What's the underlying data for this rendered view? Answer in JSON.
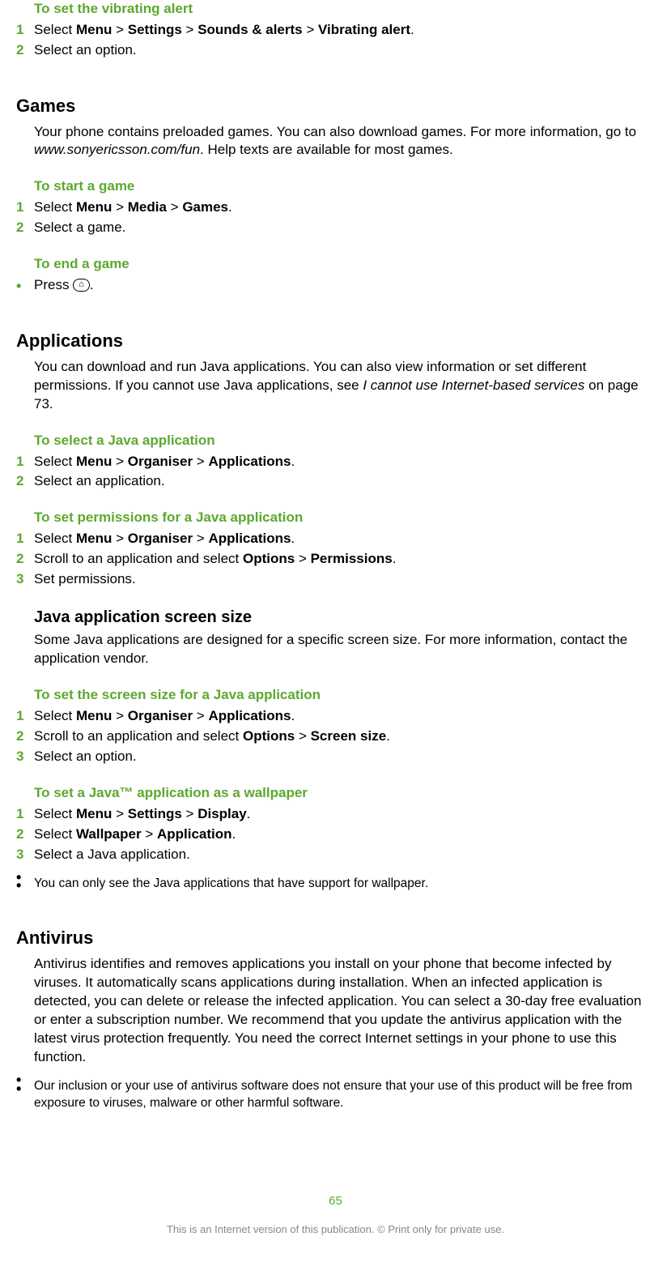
{
  "sec_vibrating": {
    "heading": "To set the vibrating alert",
    "steps": [
      {
        "n": "1",
        "html": "Select <b>Menu</b> > <b>Settings</b> > <b>Sounds & alerts</b> > <b>Vibrating alert</b>."
      },
      {
        "n": "2",
        "html": "Select an option."
      }
    ]
  },
  "sec_games": {
    "title": "Games",
    "intro_html": "Your phone contains preloaded games. You can also download games. For more information, go to <i>www.sonyericsson.com/fun</i>. Help texts are available for most games.",
    "start": {
      "heading": "To start a game",
      "steps": [
        {
          "n": "1",
          "html": "Select <b>Menu</b> > <b>Media</b> > <b>Games</b>."
        },
        {
          "n": "2",
          "html": "Select a game."
        }
      ]
    },
    "end": {
      "heading": "To end a game",
      "bullet_html": "Press <span class='icon-key'>⌂</span>."
    }
  },
  "sec_apps": {
    "title": "Applications",
    "intro_html": "You can download and run Java applications. You can also view information or set different permissions. If you cannot use Java applications, see <i>I cannot use Internet-based services</i> on page 73.",
    "select": {
      "heading": "To select a Java application",
      "steps": [
        {
          "n": "1",
          "html": "Select <b>Menu</b> > <b>Organiser</b> > <b>Applications</b>."
        },
        {
          "n": "2",
          "html": "Select an application."
        }
      ]
    },
    "perm": {
      "heading": "To set permissions for a Java application",
      "steps": [
        {
          "n": "1",
          "html": "Select <b>Menu</b> > <b>Organiser</b> > <b>Applications</b>."
        },
        {
          "n": "2",
          "html": "Scroll to an application and select <b>Options</b> > <b>Permissions</b>."
        },
        {
          "n": "3",
          "html": "Set permissions."
        }
      ]
    },
    "size": {
      "subtitle": "Java application screen size",
      "body": "Some Java applications are designed for a specific screen size. For more information, contact the application vendor.",
      "heading": "To set the screen size for a Java application",
      "steps": [
        {
          "n": "1",
          "html": "Select <b>Menu</b> > <b>Organiser</b> > <b>Applications</b>."
        },
        {
          "n": "2",
          "html": "Scroll to an application and select <b>Options</b> > <b>Screen size</b>."
        },
        {
          "n": "3",
          "html": "Select an option."
        }
      ]
    },
    "wallpaper": {
      "heading": "To set a Java™ application as a wallpaper",
      "steps": [
        {
          "n": "1",
          "html": "Select <b>Menu</b> > <b>Settings</b> > <b>Display</b>."
        },
        {
          "n": "2",
          "html": "Select <b>Wallpaper</b> > <b>Application</b>."
        },
        {
          "n": "3",
          "html": "Select a Java application."
        }
      ],
      "note": "You can only see the Java applications that have support for wallpaper."
    }
  },
  "sec_antivirus": {
    "title": "Antivirus",
    "body": "Antivirus identifies and removes applications you install on your phone that become infected by viruses. It automatically scans applications during installation. When an infected application is detected, you can delete or release the infected application. You can select a 30-day free evaluation or enter a subscription number. We recommend that you update the antivirus application with the latest virus protection frequently. You need the correct Internet settings in your phone to use this function.",
    "note": "Our inclusion or your use of antivirus software does not ensure that your use of this product will be free from exposure to viruses, malware or other harmful software."
  },
  "footer": {
    "page": "65",
    "text": "This is an Internet version of this publication. © Print only for private use."
  }
}
